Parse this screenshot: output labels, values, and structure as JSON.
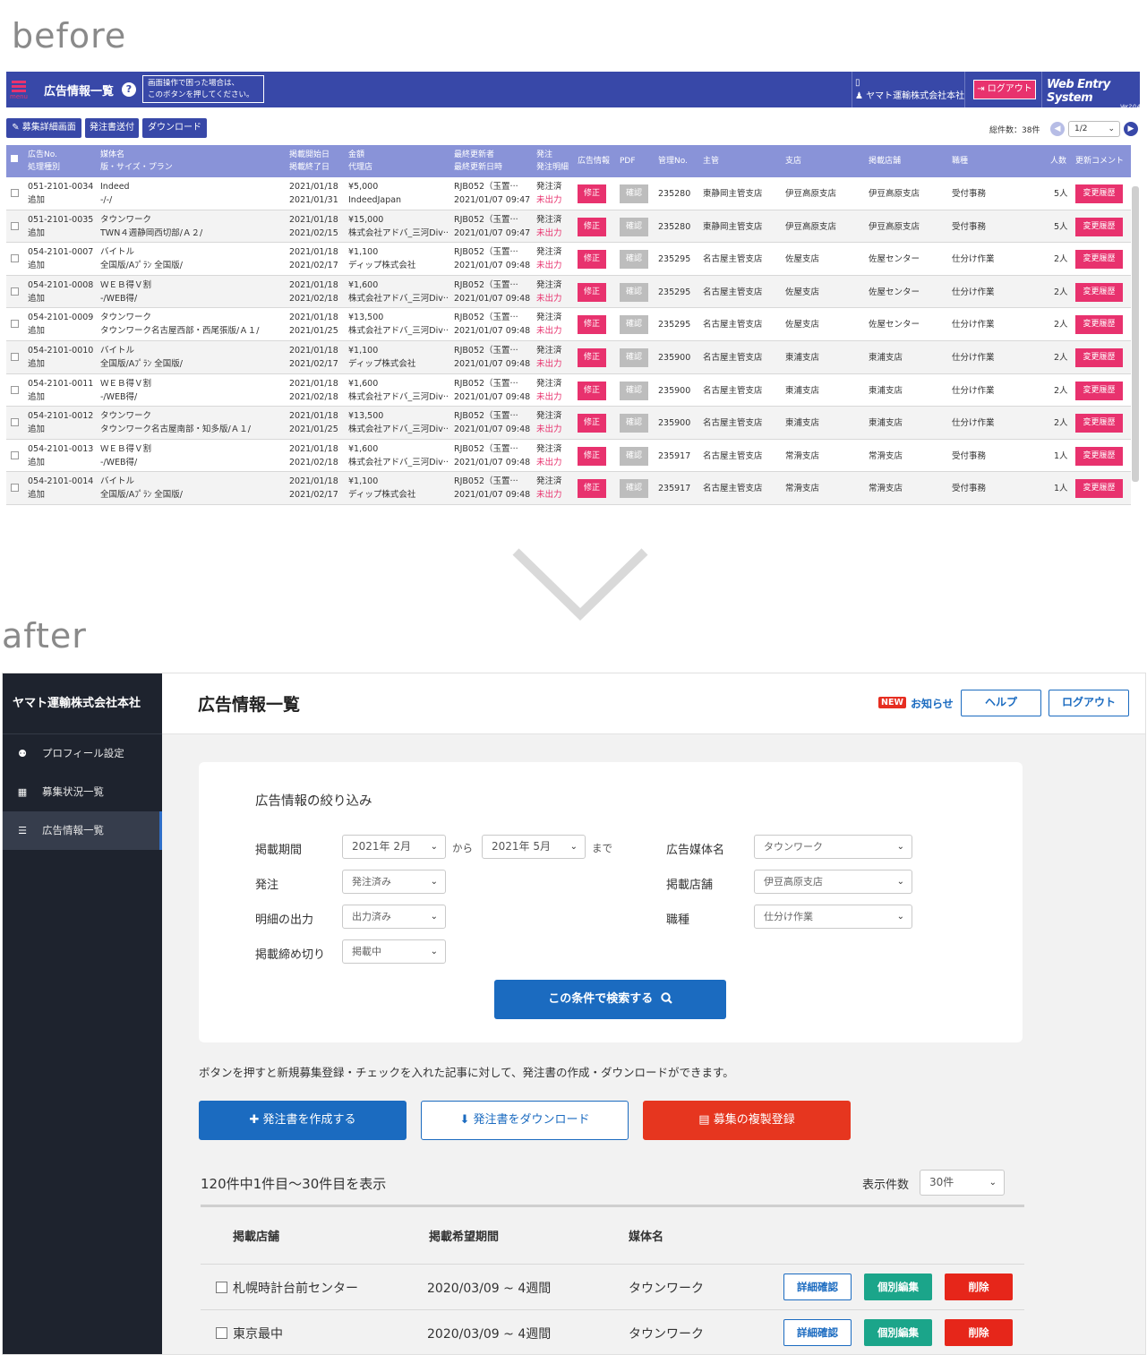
{
  "labels": {
    "before": "before",
    "after": "after"
  },
  "before": {
    "header": {
      "menu_label": "menu",
      "title": "広告情報一覧",
      "help_icon": "?",
      "help_line1": "画面操作で困った場合は、",
      "help_line2": "このボタンを押してください。",
      "company": "ヤマト運輸株式会社本社",
      "logout": "ログアウト",
      "system": "Web Entry System",
      "version": "Ver.2.0.4"
    },
    "toolbar": {
      "detail": "募集詳細画面",
      "send": "発注書送付",
      "download": "ダウンロード",
      "total": "総件数：38件",
      "page": "1/2"
    },
    "table_headers": {
      "no": "広告No.",
      "kind": "処理種別",
      "media": "媒体名",
      "plan": "版・サイズ・プラン",
      "start": "掲載開始日",
      "end": "掲載終了日",
      "amount": "金額",
      "agency": "代理店",
      "updater": "最終更新者",
      "updated": "最終更新日時",
      "order": "発注",
      "order_detail": "発注明細",
      "ad_info": "広告情報",
      "pdf": "PDF",
      "mgmt": "管理No.",
      "main": "主管",
      "branch": "支店",
      "store": "掲載店舗",
      "job": "職種",
      "people": "人数",
      "comment": "更新コメント"
    },
    "buttons": {
      "fix": "修正",
      "confirm": "確認",
      "history": "変更履歴"
    },
    "rows": [
      {
        "no": "051-2101-0034",
        "kind": "追加",
        "media": "Indeed",
        "plan": "-/-/",
        "start": "2021/01/18",
        "end": "2021/01/31",
        "amount": "¥5,000",
        "agency": "IndeedJapan",
        "updater": "RJB052（玉置···",
        "updated": "2021/01/07 09:47",
        "order": "発注済",
        "detail": "未出力",
        "mgmt": "235280",
        "main": "東静岡主管支店",
        "branch": "伊豆高原支店",
        "store": "伊豆高原支店",
        "job": "受付事務",
        "people": "5人"
      },
      {
        "no": "051-2101-0035",
        "kind": "追加",
        "media": "タウンワーク",
        "plan": "TWN４週静岡西切部/Ａ２/",
        "start": "2021/01/18",
        "end": "2021/02/15",
        "amount": "¥15,000",
        "agency": "株式会社アドバ_三河Div···",
        "updater": "RJB052（玉置···",
        "updated": "2021/01/07 09:47",
        "order": "発注済",
        "detail": "未出力",
        "mgmt": "235280",
        "main": "東静岡主管支店",
        "branch": "伊豆高原支店",
        "store": "伊豆高原支店",
        "job": "受付事務",
        "people": "5人"
      },
      {
        "no": "054-2101-0007",
        "kind": "追加",
        "media": "バイトル",
        "plan": "全国版/Aﾌﾟﾗﾝ 全国版/",
        "start": "2021/01/18",
        "end": "2021/02/17",
        "amount": "¥1,100",
        "agency": "ディップ株式会社",
        "updater": "RJB052（玉置···",
        "updated": "2021/01/07 09:48",
        "order": "発注済",
        "detail": "未出力",
        "mgmt": "235295",
        "main": "名古屋主管支店",
        "branch": "佐屋支店",
        "store": "佐屋センター",
        "job": "仕分け作業",
        "people": "2人"
      },
      {
        "no": "054-2101-0008",
        "kind": "追加",
        "media": "ＷＥＢ得Ｖ割",
        "plan": "-/WEB得/",
        "start": "2021/01/18",
        "end": "2021/02/18",
        "amount": "¥1,600",
        "agency": "株式会社アドバ_三河Div···",
        "updater": "RJB052（玉置···",
        "updated": "2021/01/07 09:48",
        "order": "発注済",
        "detail": "未出力",
        "mgmt": "235295",
        "main": "名古屋主管支店",
        "branch": "佐屋支店",
        "store": "佐屋センター",
        "job": "仕分け作業",
        "people": "2人"
      },
      {
        "no": "054-2101-0009",
        "kind": "追加",
        "media": "タウンワーク",
        "plan": "タウンワーク名古屋西部・西尾張版/Ａ１/",
        "start": "2021/01/18",
        "end": "2021/01/25",
        "amount": "¥13,500",
        "agency": "株式会社アドバ_三河Div···",
        "updater": "RJB052（玉置···",
        "updated": "2021/01/07 09:48",
        "order": "発注済",
        "detail": "未出力",
        "mgmt": "235295",
        "main": "名古屋主管支店",
        "branch": "佐屋支店",
        "store": "佐屋センター",
        "job": "仕分け作業",
        "people": "2人"
      },
      {
        "no": "054-2101-0010",
        "kind": "追加",
        "media": "バイトル",
        "plan": "全国版/Aﾌﾟﾗﾝ 全国版/",
        "start": "2021/01/18",
        "end": "2021/02/17",
        "amount": "¥1,100",
        "agency": "ディップ株式会社",
        "updater": "RJB052（玉置···",
        "updated": "2021/01/07 09:48",
        "order": "発注済",
        "detail": "未出力",
        "mgmt": "235900",
        "main": "名古屋主管支店",
        "branch": "東浦支店",
        "store": "東浦支店",
        "job": "仕分け作業",
        "people": "2人"
      },
      {
        "no": "054-2101-0011",
        "kind": "追加",
        "media": "ＷＥＢ得Ｖ割",
        "plan": "-/WEB得/",
        "start": "2021/01/18",
        "end": "2021/02/18",
        "amount": "¥1,600",
        "agency": "株式会社アドバ_三河Div···",
        "updater": "RJB052（玉置···",
        "updated": "2021/01/07 09:48",
        "order": "発注済",
        "detail": "未出力",
        "mgmt": "235900",
        "main": "名古屋主管支店",
        "branch": "東浦支店",
        "store": "東浦支店",
        "job": "仕分け作業",
        "people": "2人"
      },
      {
        "no": "054-2101-0012",
        "kind": "追加",
        "media": "タウンワーク",
        "plan": "タウンワーク名古屋南部・知多版/Ａ１/",
        "start": "2021/01/18",
        "end": "2021/01/25",
        "amount": "¥13,500",
        "agency": "株式会社アドバ_三河Div···",
        "updater": "RJB052（玉置···",
        "updated": "2021/01/07 09:48",
        "order": "発注済",
        "detail": "未出力",
        "mgmt": "235900",
        "main": "名古屋主管支店",
        "branch": "東浦支店",
        "store": "東浦支店",
        "job": "仕分け作業",
        "people": "2人"
      },
      {
        "no": "054-2101-0013",
        "kind": "追加",
        "media": "ＷＥＢ得Ｖ割",
        "plan": "-/WEB得/",
        "start": "2021/01/18",
        "end": "2021/02/18",
        "amount": "¥1,600",
        "agency": "株式会社アドバ_三河Div···",
        "updater": "RJB052（玉置···",
        "updated": "2021/01/07 09:48",
        "order": "発注済",
        "detail": "未出力",
        "mgmt": "235917",
        "main": "名古屋主管支店",
        "branch": "常滑支店",
        "store": "常滑支店",
        "job": "受付事務",
        "people": "1人"
      },
      {
        "no": "054-2101-0014",
        "kind": "追加",
        "media": "バイトル",
        "plan": "全国版/Aﾌﾟﾗﾝ 全国版/",
        "start": "2021/01/18",
        "end": "2021/02/17",
        "amount": "¥1,100",
        "agency": "ディップ株式会社",
        "updater": "RJB052（玉置···",
        "updated": "2021/01/07 09:48",
        "order": "発注済",
        "detail": "未出力",
        "mgmt": "235917",
        "main": "名古屋主管支店",
        "branch": "常滑支店",
        "store": "常滑支店",
        "job": "受付事務",
        "people": "1人"
      }
    ]
  },
  "after": {
    "sidebar": {
      "company": "ヤマト運輸株式会社本社",
      "items": [
        {
          "label": "プロフィール設定",
          "icon": "user-icon"
        },
        {
          "label": "募集状況一覧",
          "icon": "calendar-icon"
        },
        {
          "label": "広告情報一覧",
          "icon": "list-icon"
        }
      ]
    },
    "header": {
      "title": "広告情報一覧",
      "new_badge": "NEW",
      "notice": "お知らせ",
      "help": "ヘルプ",
      "logout": "ログアウト"
    },
    "filter": {
      "title": "広告情報の絞り込み",
      "period_label": "掲載期間",
      "period_from": "2021年 2月",
      "from_word": "から",
      "period_to": "2021年 5月",
      "to_word": "まで",
      "order_label": "発注",
      "order_value": "発注済み",
      "detail_label": "明細の出力",
      "detail_value": "出力済み",
      "deadline_label": "掲載締め切り",
      "deadline_value": "掲載中",
      "media_label": "広告媒体名",
      "media_value": "タウンワーク",
      "store_label": "掲載店舗",
      "store_value": "伊豆高原支店",
      "job_label": "職種",
      "job_value": "仕分け作業",
      "search_button": "この条件で検索する"
    },
    "description": "ボタンを押すと新規募集登録・チェックを入れた記事に対して、発注書の作成・ダウンロードができます。",
    "actions": {
      "create": "発注書を作成する",
      "download": "発注書をダウンロード",
      "duplicate": "募集の複製登録"
    },
    "results": {
      "summary": "120件中1件目〜30件目を表示",
      "per_page_label": "表示件数",
      "per_page_value": "30件"
    },
    "table": {
      "headers": {
        "store": "掲載店舗",
        "period": "掲載希望期間",
        "media": "媒体名"
      },
      "rows": [
        {
          "store": "札幌時計台前センター",
          "period": "2020/03/09 ~ 4週間",
          "media": "タウンワーク"
        },
        {
          "store": "東京最中",
          "period": "2020/03/09 ~ 4週間",
          "media": "タウンワーク"
        }
      ],
      "buttons": {
        "detail": "詳細確認",
        "edit": "個別編集",
        "delete": "削除"
      }
    },
    "colors": {
      "primary": "#1b6bc0",
      "sidebar": "#1e232e",
      "danger": "#e6361f",
      "success": "#1ba58a"
    }
  }
}
